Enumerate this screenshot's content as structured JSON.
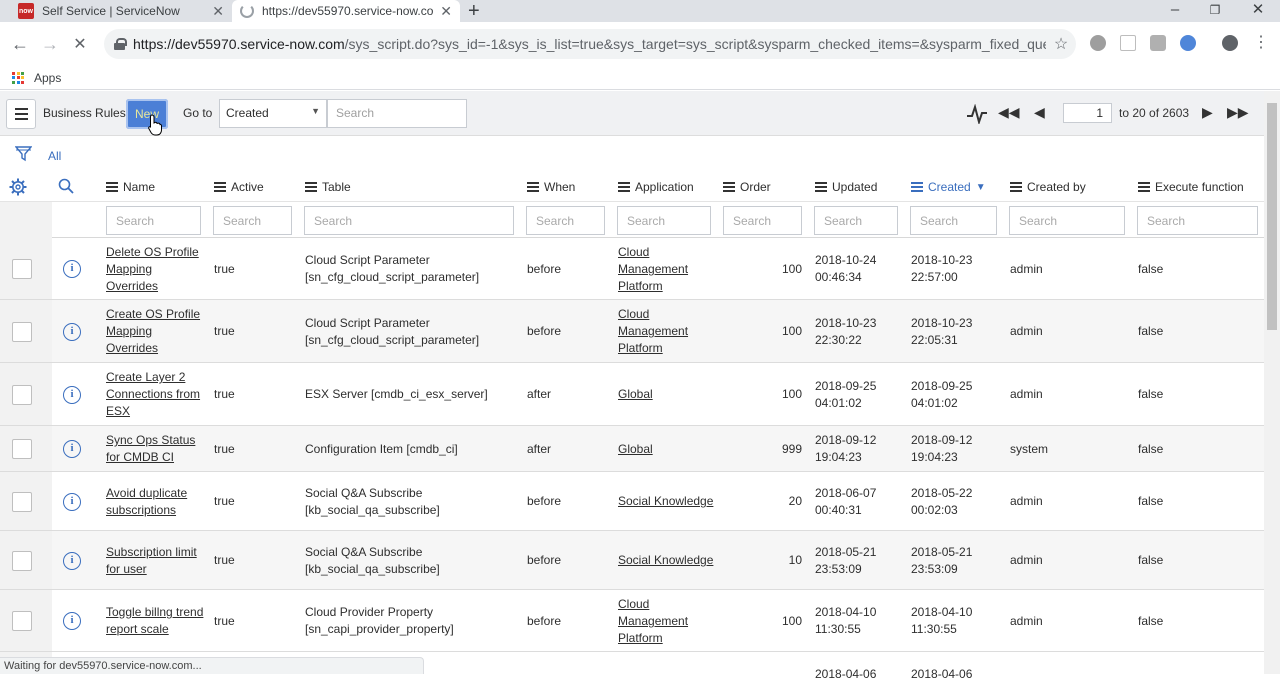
{
  "browser": {
    "tabs": [
      {
        "title": "Self Service | ServiceNow",
        "favicon": "now"
      },
      {
        "title": "https://dev55970.service-now.co"
      }
    ],
    "url_host": "https://dev55970.service-now.com",
    "url_path": "/sys_script.do?sys_id=-1&sys_is_list=true&sys_target=sys_script&sysparm_checked_items=&sysparm_fixed_query=&sys...",
    "bookmarks_label": "Apps",
    "status_text": "Waiting for dev55970.service-now.com..."
  },
  "list": {
    "title": "Business Rules",
    "new_label": "New",
    "goto_label": "Go to",
    "goto_field": "Created",
    "search_placeholder": "Search",
    "page_value": "1",
    "page_text": "to 20 of 2603",
    "filter_label": "All"
  },
  "columns": [
    "Name",
    "Active",
    "Table",
    "When",
    "Application",
    "Order",
    "Updated",
    "Created",
    "Created by",
    "Execute function"
  ],
  "column_search_placeholder": "Search",
  "rows": [
    {
      "name": [
        "Delete OS Profile",
        "Mapping",
        "Overrides"
      ],
      "active": "true",
      "table": [
        "Cloud Script Parameter",
        "[sn_cfg_cloud_script_parameter]"
      ],
      "when": "before",
      "application": [
        "Cloud",
        "Management",
        "Platform"
      ],
      "order": "100",
      "updated": [
        "2018-10-24",
        "00:46:34"
      ],
      "created": [
        "2018-10-23",
        "22:57:00"
      ],
      "created_by": "admin",
      "execute": "false"
    },
    {
      "name": [
        "Create OS Profile",
        "Mapping",
        "Overrides"
      ],
      "active": "true",
      "table": [
        "Cloud Script Parameter",
        "[sn_cfg_cloud_script_parameter]"
      ],
      "when": "before",
      "application": [
        "Cloud",
        "Management",
        "Platform"
      ],
      "order": "100",
      "updated": [
        "2018-10-23",
        "22:30:22"
      ],
      "created": [
        "2018-10-23",
        "22:05:31"
      ],
      "created_by": "admin",
      "execute": "false"
    },
    {
      "name": [
        "Create Layer 2",
        "Connections from",
        "ESX"
      ],
      "active": "true",
      "table": [
        "ESX Server [cmdb_ci_esx_server]"
      ],
      "when": "after",
      "application": [
        "Global"
      ],
      "order": "100",
      "updated": [
        "2018-09-25",
        "04:01:02"
      ],
      "created": [
        "2018-09-25",
        "04:01:02"
      ],
      "created_by": "admin",
      "execute": "false"
    },
    {
      "name": [
        "Sync Ops Status",
        "for CMDB CI"
      ],
      "active": "true",
      "table": [
        "Configuration Item [cmdb_ci]"
      ],
      "when": "after",
      "application": [
        "Global"
      ],
      "order": "999",
      "updated": [
        "2018-09-12",
        "19:04:23"
      ],
      "created": [
        "2018-09-12",
        "19:04:23"
      ],
      "created_by": "system",
      "execute": "false"
    },
    {
      "name": [
        "Avoid duplicate",
        "subscriptions"
      ],
      "active": "true",
      "table": [
        "Social Q&A Subscribe",
        "[kb_social_qa_subscribe]"
      ],
      "when": "before",
      "application": [
        "Social Knowledge"
      ],
      "order": "20",
      "updated": [
        "2018-06-07",
        "00:40:31"
      ],
      "created": [
        "2018-05-22",
        "00:02:03"
      ],
      "created_by": "admin",
      "execute": "false"
    },
    {
      "name": [
        "Subscription limit",
        "for user"
      ],
      "active": "true",
      "table": [
        "Social Q&A Subscribe",
        "[kb_social_qa_subscribe]"
      ],
      "when": "before",
      "application": [
        "Social Knowledge"
      ],
      "order": "10",
      "updated": [
        "2018-05-21",
        "23:53:09"
      ],
      "created": [
        "2018-05-21",
        "23:53:09"
      ],
      "created_by": "admin",
      "execute": "false"
    },
    {
      "name": [
        "Toggle billng trend",
        "report scale"
      ],
      "active": "true",
      "table": [
        "Cloud Provider Property",
        "[sn_capi_provider_property]"
      ],
      "when": "before",
      "application": [
        "Cloud",
        "Management",
        "Platform"
      ],
      "order": "100",
      "updated": [
        "2018-04-10",
        "11:30:55"
      ],
      "created": [
        "2018-04-10",
        "11:30:55"
      ],
      "created_by": "admin",
      "execute": "false"
    }
  ],
  "partial_row": {
    "updated": "2018-04-06",
    "created": "2018-04-06"
  },
  "colors": {
    "accent": "#3a6ebe",
    "new_button": "#4b7fd6",
    "favicon": "#c62828"
  }
}
